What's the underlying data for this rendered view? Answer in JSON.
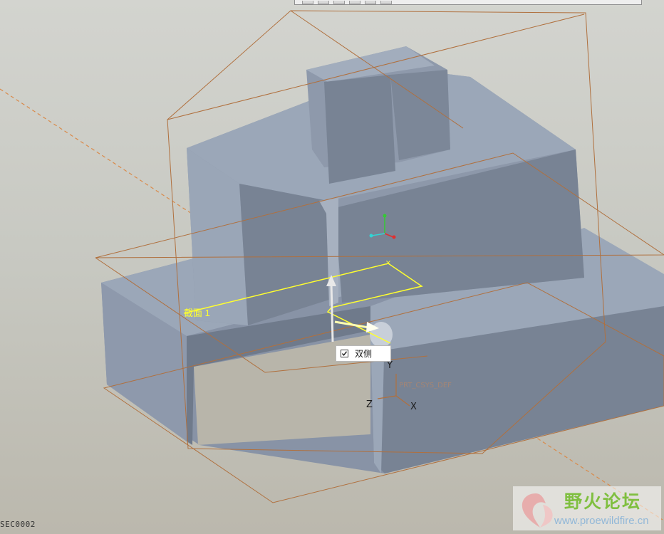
{
  "toolbar": {
    "buttons": [
      "toolbar-button",
      "toolbar-button",
      "toolbar-button",
      "toolbar-button",
      "toolbar-button",
      "toolbar-button"
    ]
  },
  "viewport": {
    "section_label": "截面 1",
    "axis_y": "Y",
    "axis_z": "Z",
    "axis_x": "X",
    "csys_name": "PRT_CSYS_DEF"
  },
  "option": {
    "label": "双侧",
    "checked": true
  },
  "status": {
    "model_name": "SEC0002"
  },
  "watermark": {
    "title": "野火论坛",
    "url": "www.proewildfire.cn"
  },
  "colors": {
    "datum_plane": "#b0703e",
    "section_outline": "#ffff2e",
    "model_face_light": "#9ba7b8",
    "model_face_dark": "#788394",
    "csys_green": "#34c934",
    "csys_red": "#e03030",
    "csys_cyan": "#32d4d4"
  }
}
